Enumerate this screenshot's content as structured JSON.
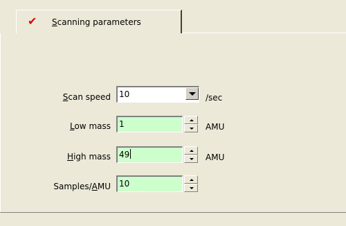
{
  "tab": {
    "label_prefix": "S",
    "label_rest": "canning parameters",
    "icon": "checkmark-icon"
  },
  "fields": {
    "scan_speed": {
      "label_prefix": "S",
      "label_rest": "can speed",
      "value": "10",
      "unit": "/sec"
    },
    "low_mass": {
      "label_prefix": "L",
      "label_rest": "ow mass",
      "value": "1",
      "unit": "AMU"
    },
    "high_mass": {
      "label_prefix": "H",
      "label_rest": "igh mass",
      "value": "49",
      "unit": "AMU"
    },
    "samples_amu": {
      "label_pre": "Samples/",
      "label_ul": "A",
      "label_rest": "MU",
      "value": "10"
    }
  },
  "colors": {
    "input_bg": "#ccffcc",
    "check": "#e00000",
    "panel_bg": "#ece9d8"
  }
}
